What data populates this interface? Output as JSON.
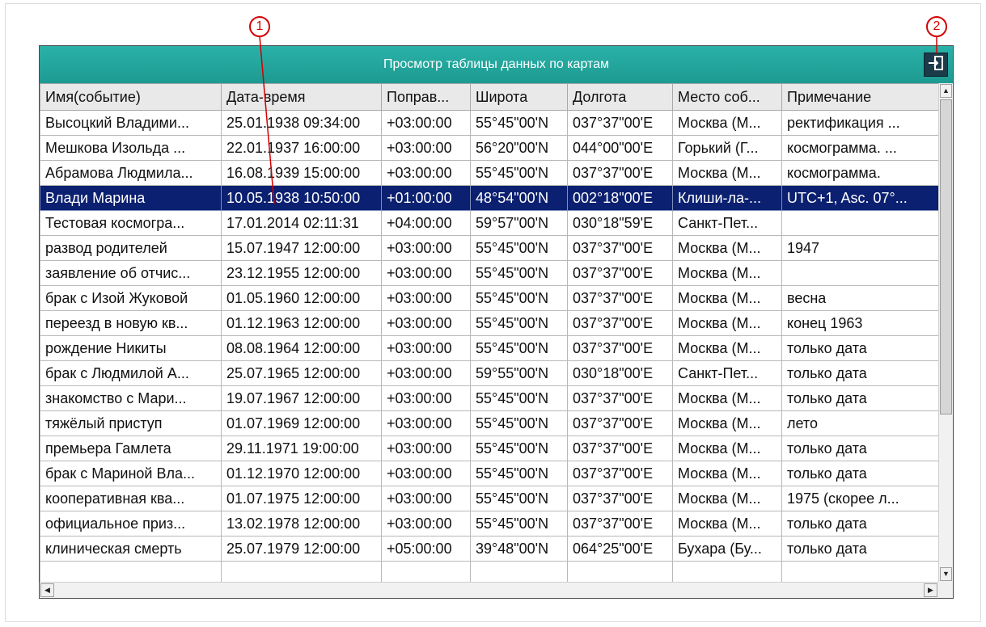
{
  "window": {
    "title": "Просмотр таблицы данных по картам"
  },
  "callouts": [
    "1",
    "2"
  ],
  "table": {
    "columns": [
      "Имя(событие)",
      "Дата-время",
      "Поправ...",
      "Широта",
      "Долгота",
      "Место соб...",
      "Примечание"
    ],
    "selected_row": 3,
    "rows": [
      [
        "Высоцкий Владими...",
        "25.01.1938 09:34:00",
        "+03:00:00",
        "55°45\"00'N",
        "037°37\"00'E",
        "Москва (М...",
        "ректификация ..."
      ],
      [
        "Мешкова Изольда ...",
        "22.01.1937 16:00:00",
        "+03:00:00",
        "56°20\"00'N",
        "044°00\"00'E",
        "Горький (Г...",
        "космограмма. ..."
      ],
      [
        "Абрамова Людмила...",
        "16.08.1939 15:00:00",
        "+03:00:00",
        "55°45\"00'N",
        "037°37\"00'E",
        "Москва (М...",
        "космограмма."
      ],
      [
        "Влади Марина",
        "10.05.1938 10:50:00",
        "+01:00:00",
        "48°54\"00'N",
        "002°18\"00'E",
        "Клиши-ла-...",
        "UTC+1, Asc. 07°..."
      ],
      [
        "Тестовая космогра...",
        "17.01.2014 02:11:31",
        "+04:00:00",
        "59°57\"00'N",
        "030°18\"59'E",
        "Санкт-Пет...",
        ""
      ],
      [
        "развод родителей",
        "15.07.1947 12:00:00",
        "+03:00:00",
        "55°45\"00'N",
        "037°37\"00'E",
        "Москва (М...",
        "1947"
      ],
      [
        "заявление об отчис...",
        "23.12.1955 12:00:00",
        "+03:00:00",
        "55°45\"00'N",
        "037°37\"00'E",
        "Москва (М...",
        ""
      ],
      [
        "брак с Изой Жуковой",
        "01.05.1960 12:00:00",
        "+03:00:00",
        "55°45\"00'N",
        "037°37\"00'E",
        "Москва (М...",
        "весна"
      ],
      [
        "переезд в новую кв...",
        "01.12.1963 12:00:00",
        "+03:00:00",
        "55°45\"00'N",
        "037°37\"00'E",
        "Москва (М...",
        "конец 1963"
      ],
      [
        "рождение Никиты",
        "08.08.1964 12:00:00",
        "+03:00:00",
        "55°45\"00'N",
        "037°37\"00'E",
        "Москва (М...",
        "только дата"
      ],
      [
        "брак с Людмилой А...",
        "25.07.1965 12:00:00",
        "+03:00:00",
        "59°55\"00'N",
        "030°18\"00'E",
        "Санкт-Пет...",
        "только дата"
      ],
      [
        "знакомство с Мари...",
        "19.07.1967 12:00:00",
        "+03:00:00",
        "55°45\"00'N",
        "037°37\"00'E",
        "Москва (М...",
        "только дата"
      ],
      [
        "тяжёлый приступ",
        "01.07.1969 12:00:00",
        "+03:00:00",
        "55°45\"00'N",
        "037°37\"00'E",
        "Москва (М...",
        "лето"
      ],
      [
        "премьера Гамлета",
        "29.11.1971 19:00:00",
        "+03:00:00",
        "55°45\"00'N",
        "037°37\"00'E",
        "Москва (М...",
        "только дата"
      ],
      [
        "брак с Мариной Вла...",
        "01.12.1970 12:00:00",
        "+03:00:00",
        "55°45\"00'N",
        "037°37\"00'E",
        "Москва (М...",
        "только дата"
      ],
      [
        "кооперативная ква...",
        "01.07.1975 12:00:00",
        "+03:00:00",
        "55°45\"00'N",
        "037°37\"00'E",
        "Москва (М...",
        "1975 (скорее л..."
      ],
      [
        "официальное приз...",
        "13.02.1978 12:00:00",
        "+03:00:00",
        "55°45\"00'N",
        "037°37\"00'E",
        "Москва (М...",
        "только дата"
      ],
      [
        "клиническая смерть",
        "25.07.1979 12:00:00",
        "+05:00:00",
        "39°48\"00'N",
        "064°25\"00'E",
        "Бухара (Бу...",
        "только дата"
      ],
      [
        "",
        "",
        "",
        "",
        "",
        "",
        ""
      ]
    ]
  },
  "icons": {
    "exit": "exit-icon",
    "scroll_up": "scroll-up-arrow-icon",
    "scroll_down": "scroll-down-arrow-icon",
    "scroll_left": "scroll-left-arrow-icon",
    "scroll_right": "scroll-right-arrow-icon"
  },
  "colors": {
    "titlebar": "#22a89f",
    "selection": "#0b2070",
    "callout": "#d20000"
  }
}
